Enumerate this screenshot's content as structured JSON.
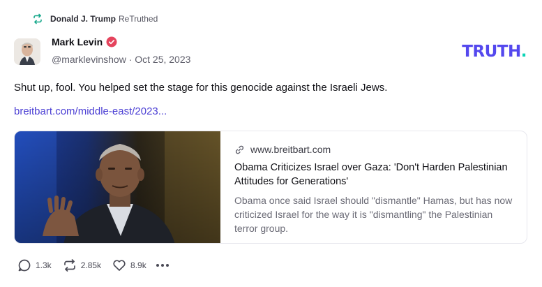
{
  "retruth": {
    "user": "Donald J. Trump",
    "label": "ReTruthed",
    "icon": "retruth-icon"
  },
  "author": {
    "name": "Mark Levin",
    "handle_date": "@marklevinshow · Oct 25, 2023",
    "verified_icon": "verified-badge-icon",
    "avatar_icon": "avatar"
  },
  "brand": {
    "logo_text": "TRUTH",
    "logo_dot": ".",
    "primary": "#5448ee",
    "accent": "#0bd4b6"
  },
  "post": {
    "text": "Shut up, fool. You helped set the stage for this genocide against the Israeli Jews.",
    "link": "breitbart.com/middle-east/2023..."
  },
  "card": {
    "domain": "www.breitbart.com",
    "title": "Obama Criticizes Israel over Gaza: 'Don't Harden Palestinian Attitudes for Generations'",
    "description": "Obama once said Israel should \"dismantle\" Hamas, but has now criticized Israel for the way it is \"dismantling\" the Palestinian terror group.",
    "link_icon": "link-icon"
  },
  "actions": {
    "replies": "1.3k",
    "retruths": "2.85k",
    "likes": "8.9k"
  }
}
